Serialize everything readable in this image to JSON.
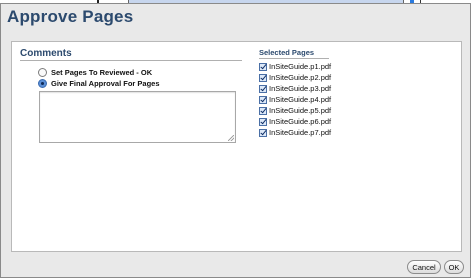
{
  "dialog": {
    "title": "Approve Pages"
  },
  "comments": {
    "header": "Comments",
    "options": [
      {
        "label": "Set Pages To Reviewed - OK",
        "selected": false
      },
      {
        "label": "Give Final Approval For Pages",
        "selected": true
      }
    ],
    "textarea_value": ""
  },
  "selected_pages": {
    "header": "Selected Pages",
    "items": [
      {
        "label": "InSiteGuide.p1.pdf",
        "checked": true
      },
      {
        "label": "InSiteGuide.p2.pdf",
        "checked": true
      },
      {
        "label": "InSiteGuide.p3.pdf",
        "checked": true
      },
      {
        "label": "InSiteGuide.p4.pdf",
        "checked": true
      },
      {
        "label": "InSiteGuide.p5.pdf",
        "checked": true
      },
      {
        "label": "InSiteGuide.p6.pdf",
        "checked": true
      },
      {
        "label": "InSiteGuide.p7.pdf",
        "checked": true
      }
    ]
  },
  "buttons": {
    "cancel_label": "Cancel",
    "ok_label": "OK"
  },
  "colors": {
    "title": "#2c4a6e",
    "radio_selected": "#5b8fd6",
    "checkbox_fill": "#dce8f8"
  }
}
